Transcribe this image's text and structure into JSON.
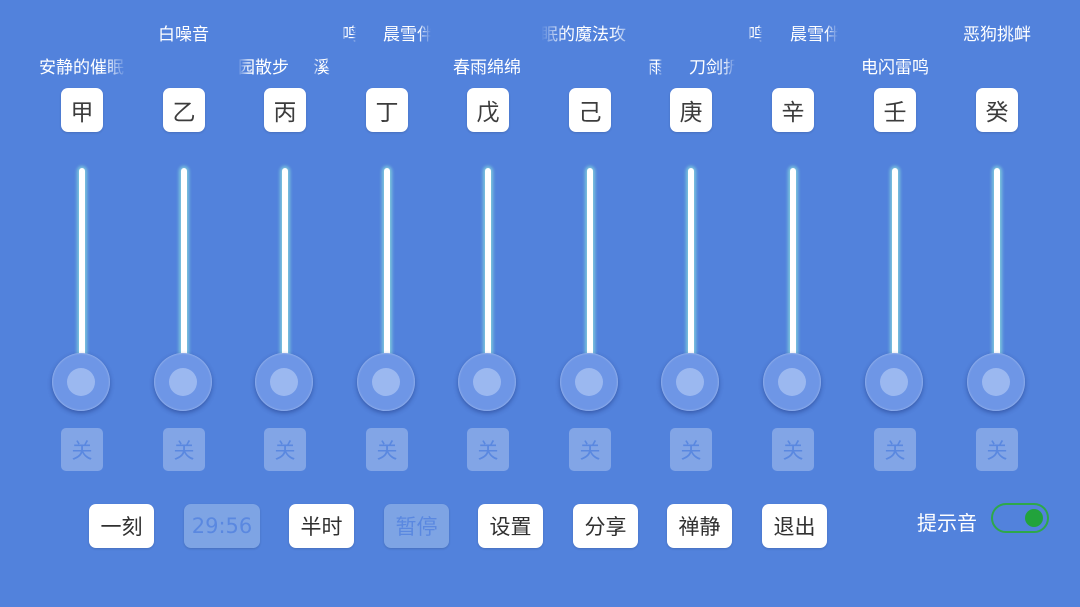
{
  "sound_labels": [
    {
      "text": "白噪音"
    },
    {
      "text": "晨雪伴"
    },
    {
      "text": "眠的魔法攻"
    },
    {
      "text": "晨雪伴"
    },
    {
      "text": "恶狗挑衅"
    },
    {
      "text": "安静的催眠"
    },
    {
      "text": "园散步"
    },
    {
      "text": "溪"
    },
    {
      "text": "春雨绵绵"
    },
    {
      "text": "雨"
    },
    {
      "text": "刀剑折"
    },
    {
      "text": "电闪雷鸣"
    },
    {
      "text": "鸣"
    },
    {
      "text": "鸣"
    }
  ],
  "channels": [
    {
      "name": "甲",
      "state": "关",
      "level": 0
    },
    {
      "name": "乙",
      "state": "关",
      "level": 0
    },
    {
      "name": "丙",
      "state": "关",
      "level": 0
    },
    {
      "name": "丁",
      "state": "关",
      "level": 0
    },
    {
      "name": "戊",
      "state": "关",
      "level": 0
    },
    {
      "name": "己",
      "state": "关",
      "level": 0
    },
    {
      "name": "庚",
      "state": "关",
      "level": 0
    },
    {
      "name": "辛",
      "state": "关",
      "level": 0
    },
    {
      "name": "壬",
      "state": "关",
      "level": 0
    },
    {
      "name": "癸",
      "state": "关",
      "level": 0
    }
  ],
  "bottom_bar": {
    "quarter": "一刻",
    "timer": "29:56",
    "half_hour": "半时",
    "pause": "暂停",
    "settings": "设置",
    "share": "分享",
    "zen": "禅静",
    "exit": "退出",
    "prompt_sound_label": "提示音",
    "prompt_sound_on": true
  },
  "colors": {
    "background": "#5282dc",
    "toggle_accent": "#22a33c"
  }
}
